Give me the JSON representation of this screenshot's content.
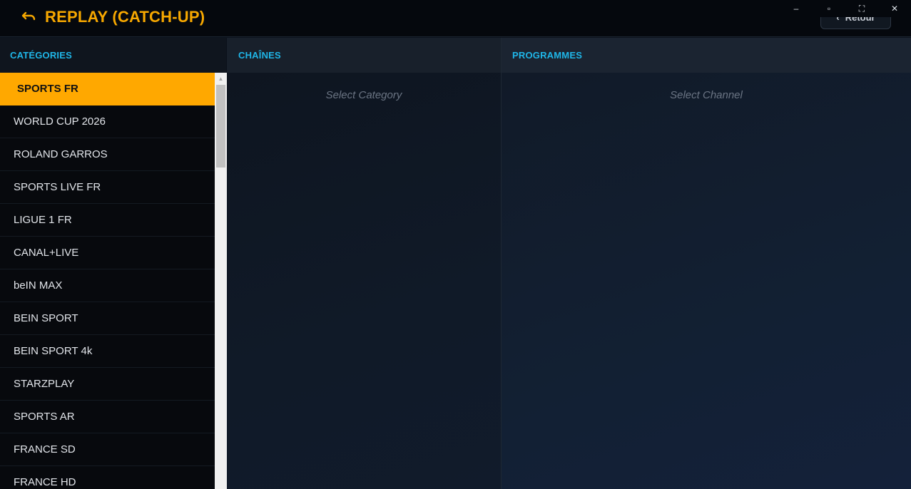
{
  "header": {
    "title": "REPLAY (CATCH-UP)",
    "back_icon": "undo-arrow-icon",
    "retour_label": "Retour"
  },
  "window_controls": {
    "minimize": "–",
    "restore": "▫",
    "fullscreen": "⛶",
    "close": "✕"
  },
  "columns": {
    "categories": "CATÉGORIES",
    "channels": "CHAÎNES",
    "programs": "PROGRAMMES"
  },
  "categories": [
    {
      "label": "SPORTS FR",
      "active": true
    },
    {
      "label": "WORLD CUP 2026"
    },
    {
      "label": "ROLAND GARROS"
    },
    {
      "label": "SPORTS LIVE FR"
    },
    {
      "label": "LIGUE 1 FR"
    },
    {
      "label": "CANAL+LIVE"
    },
    {
      "label": "beIN MAX"
    },
    {
      "label": "BEIN SPORT"
    },
    {
      "label": "BEIN SPORT 4k"
    },
    {
      "label": "STARZPLAY"
    },
    {
      "label": "SPORTS AR"
    },
    {
      "label": "FRANCE SD"
    },
    {
      "label": "FRANCE HD"
    }
  ],
  "channels_panel": {
    "placeholder": "Select Category"
  },
  "programs_panel": {
    "placeholder": "Select Channel"
  },
  "colors": {
    "accent": "#ffa800",
    "column_header_text": "#1fb6e8"
  }
}
